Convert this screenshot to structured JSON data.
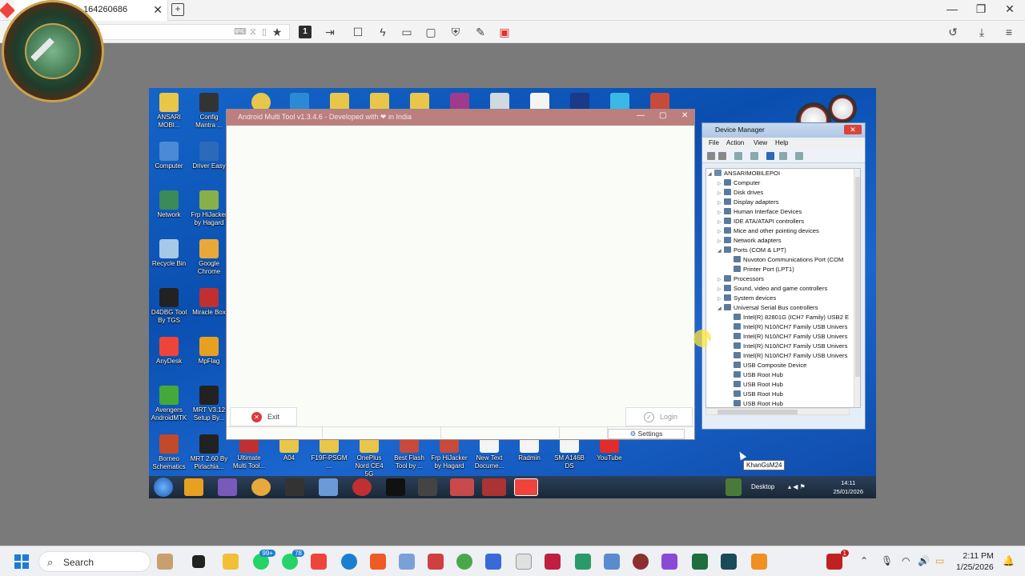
{
  "host": {
    "tab_title": "164260686",
    "address_partial": "6",
    "monitor_number": "1"
  },
  "remote": {
    "desktop_icons": [
      {
        "label": "ANSARI MOBI...",
        "color": "#e8c64a"
      },
      {
        "label": "Config Mantra ...",
        "color": "#333333"
      },
      {
        "label": "Computer",
        "color": "#4a8ad6"
      },
      {
        "label": "Driver Easy",
        "color": "#2a6ab8"
      },
      {
        "label": "Network",
        "color": "#3a8a5a"
      },
      {
        "label": "Frp HiJacker by Hagard",
        "color": "#88b04a"
      },
      {
        "label": "Recycle Bin",
        "color": "#a8c8e8"
      },
      {
        "label": "Google Chrome",
        "color": "#e8a93a"
      },
      {
        "label": "D4DBG Tool By TGS",
        "color": "#222222"
      },
      {
        "label": "Miracle Box",
        "color": "#c03030"
      },
      {
        "label": "AnyDesk",
        "color": "#ef443b"
      },
      {
        "label": "MpFlag",
        "color": "#e8a020"
      },
      {
        "label": "Avengers AndroidMTK",
        "color": "#44a83a"
      },
      {
        "label": "MRT V3.12 Setup By...",
        "color": "#222222"
      },
      {
        "label": "Borneo Schematics",
        "color": "#c04a2a"
      },
      {
        "label": "MRT 2.60 By Pirlachia...",
        "color": "#222222"
      }
    ],
    "bottom_icons": [
      {
        "label": "Ultimate Multi Tool...",
        "color": "#c03030"
      },
      {
        "label": "A04",
        "color": "#e8c64a"
      },
      {
        "label": "F19F-PSGM ...",
        "color": "#e8c64a"
      },
      {
        "label": "OnePlus Nord CE4 5G",
        "color": "#e8c64a"
      },
      {
        "label": "Best Flash Tool by ...",
        "color": "#c84a3a"
      },
      {
        "label": "Frp HiJacker by Hagard",
        "color": "#c84a3a"
      },
      {
        "label": "New Text Docume...",
        "color": "#f4f4f4"
      },
      {
        "label": "Radmin",
        "color": "#f4f4f4"
      },
      {
        "label": "SM A146B DS",
        "color": "#f4f4f4"
      },
      {
        "label": "YouTube",
        "color": "#e32b2b"
      }
    ],
    "android_tool": {
      "title": "Android Multi Tool v1.3.4.6 - Developed with ❤ in India",
      "exit_label": "Exit",
      "login_label": "Login",
      "settings_label": "Settings"
    },
    "device_manager": {
      "title": "Device Manager",
      "menu": [
        "File",
        "Action",
        "View",
        "Help"
      ],
      "root": "ANSARIMOBILEPOI",
      "tree": [
        {
          "label": "Computer",
          "level": 1,
          "expander": "▷"
        },
        {
          "label": "Disk drives",
          "level": 1,
          "expander": "▷"
        },
        {
          "label": "Display adapters",
          "level": 1,
          "expander": "▷"
        },
        {
          "label": "Human Interface Devices",
          "level": 1,
          "expander": "▷"
        },
        {
          "label": "IDE ATA/ATAPI controllers",
          "level": 1,
          "expander": "▷"
        },
        {
          "label": "Mice and other pointing devices",
          "level": 1,
          "expander": "▷"
        },
        {
          "label": "Network adapters",
          "level": 1,
          "expander": "▷"
        },
        {
          "label": "Ports (COM & LPT)",
          "level": 1,
          "expander": "◢"
        },
        {
          "label": "Nuvoton Communications Port (COM",
          "level": 2,
          "expander": ""
        },
        {
          "label": "Printer Port (LPT1)",
          "level": 2,
          "expander": ""
        },
        {
          "label": "Processors",
          "level": 1,
          "expander": "▷"
        },
        {
          "label": "Sound, video and game controllers",
          "level": 1,
          "expander": "▷"
        },
        {
          "label": "System devices",
          "level": 1,
          "expander": "▷"
        },
        {
          "label": "Universal Serial Bus controllers",
          "level": 1,
          "expander": "◢"
        },
        {
          "label": "Intel(R) 82801G (ICH7 Family) USB2 E",
          "level": 2,
          "expander": ""
        },
        {
          "label": "Intel(R) N10/ICH7 Family USB Univers",
          "level": 2,
          "expander": ""
        },
        {
          "label": "Intel(R) N10/ICH7 Family USB Univers",
          "level": 2,
          "expander": ""
        },
        {
          "label": "Intel(R) N10/ICH7 Family USB Univers",
          "level": 2,
          "expander": ""
        },
        {
          "label": "Intel(R) N10/ICH7 Family USB Univers",
          "level": 2,
          "expander": ""
        },
        {
          "label": "USB Composite Device",
          "level": 2,
          "expander": ""
        },
        {
          "label": "USB Root Hub",
          "level": 2,
          "expander": ""
        },
        {
          "label": "USB Root Hub",
          "level": 2,
          "expander": ""
        },
        {
          "label": "USB Root Hub",
          "level": 2,
          "expander": ""
        },
        {
          "label": "USB Root Hub",
          "level": 2,
          "expander": ""
        }
      ]
    },
    "tooltip": "KhanGsM24",
    "taskbar": {
      "desktop_label": "Desktop",
      "time": "14:11",
      "date": "25/01/2026"
    }
  },
  "w11": {
    "search_label": "Search",
    "badges": [
      "99+",
      "78",
      "1"
    ],
    "time": "2:11 PM",
    "date": "1/25/2026"
  }
}
